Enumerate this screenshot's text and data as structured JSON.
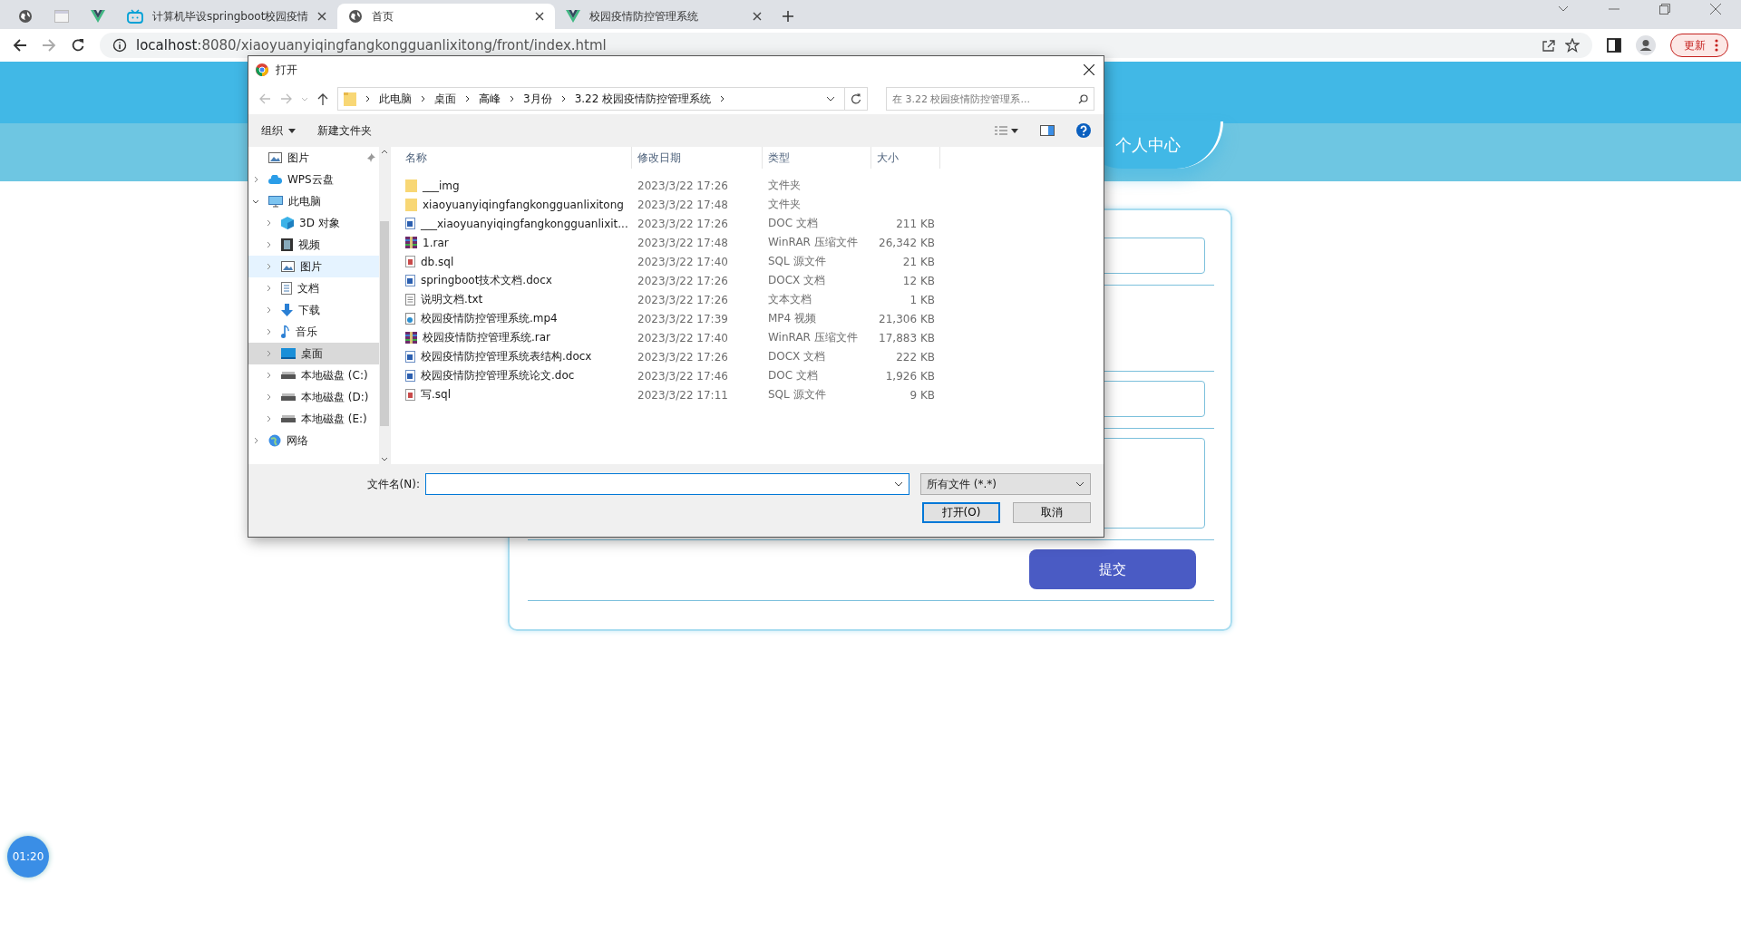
{
  "browser": {
    "tabs": [
      {
        "kind": "globe",
        "selected": false
      },
      {
        "kind": "blank",
        "selected": false
      },
      {
        "kind": "vue",
        "selected": false
      },
      {
        "label": "计算机毕设springboot校园疫情",
        "kind": "tv",
        "selected": false
      },
      {
        "label": "首页",
        "kind": "globe",
        "selected": true
      },
      {
        "label": "校园疫情防控管理系统",
        "kind": "vue",
        "selected": false
      }
    ],
    "address": {
      "host": "localhost",
      "rest": ":8080/xiaoyuanyiqingfangkongguanlixitong/front/index.html"
    },
    "update_button": "更新"
  },
  "page": {
    "nav_tab": "个人中心",
    "form": {
      "submit": "提交"
    },
    "timer": "01:20"
  },
  "dialog": {
    "title": "打开",
    "breadcrumb": [
      "此电脑",
      "桌面",
      "高峰",
      "3月份",
      "3.22  校园疫情防控管理系统"
    ],
    "search_placeholder": "在 3.22  校园疫情防控管理系...",
    "toolbar": {
      "organize": "组织",
      "new_folder": "新建文件夹"
    },
    "sidebar": [
      {
        "label": "图片",
        "kind": "picture",
        "pinned": true,
        "selected": false,
        "hover": false
      },
      {
        "label": "WPS云盘",
        "kind": "cloud",
        "selected": false,
        "hover": false,
        "expanded": false
      },
      {
        "label": "此电脑",
        "kind": "pc",
        "selected": false,
        "hover": false,
        "expanded": true,
        "children": [
          {
            "label": "3D 对象",
            "kind": "cube",
            "selected": false,
            "hover": false
          },
          {
            "label": "视频",
            "kind": "film",
            "selected": false,
            "hover": false
          },
          {
            "label": "图片",
            "kind": "picture",
            "selected": false,
            "hover": true
          },
          {
            "label": "文档",
            "kind": "doc",
            "selected": false,
            "hover": false
          },
          {
            "label": "下载",
            "kind": "download",
            "selected": false,
            "hover": false
          },
          {
            "label": "音乐",
            "kind": "music",
            "selected": false,
            "hover": false
          },
          {
            "label": "桌面",
            "kind": "desktop",
            "selected": true,
            "hover": false
          },
          {
            "label": "本地磁盘 (C:)",
            "kind": "drive",
            "selected": false,
            "hover": false
          },
          {
            "label": "本地磁盘 (D:)",
            "kind": "drive",
            "selected": false,
            "hover": false
          },
          {
            "label": "本地磁盘 (E:)",
            "kind": "drive",
            "selected": false,
            "hover": false
          }
        ]
      },
      {
        "label": "网络",
        "kind": "network",
        "selected": false,
        "hover": false,
        "expanded": false
      }
    ],
    "columns": [
      "名称",
      "修改日期",
      "类型",
      "大小"
    ],
    "files": [
      {
        "kind": "folder",
        "name": "___img",
        "date": "2023/3/22 17:26",
        "type": "文件夹"
      },
      {
        "kind": "folder",
        "name": "xiaoyuanyiqingfangkongguanlixitong",
        "date": "2023/3/22 17:48",
        "type": "文件夹"
      },
      {
        "kind": "word",
        "name": "___xiaoyuanyiqingfangkongguanlixit...",
        "date": "2023/3/22 17:26",
        "type": "DOC 文档",
        "size": "211 KB"
      },
      {
        "kind": "rar",
        "name": "1.rar",
        "date": "2023/3/22 17:48",
        "type": "WinRAR 压缩文件",
        "size": "26,342 KB"
      },
      {
        "kind": "sql",
        "name": "db.sql",
        "date": "2023/3/22 17:40",
        "type": "SQL 源文件",
        "size": "21 KB"
      },
      {
        "kind": "word",
        "name": "springboot技术文档.docx",
        "date": "2023/3/22 17:26",
        "type": "DOCX 文档",
        "size": "12 KB"
      },
      {
        "kind": "text",
        "name": "说明文档.txt",
        "date": "2023/3/22 17:26",
        "type": "文本文档",
        "size": "1 KB"
      },
      {
        "kind": "video",
        "name": "校园疫情防控管理系统.mp4",
        "date": "2023/3/22 17:39",
        "type": "MP4 视频",
        "size": "21,306 KB"
      },
      {
        "kind": "rar",
        "name": "校园疫情防控管理系统.rar",
        "date": "2023/3/22 17:40",
        "type": "WinRAR 压缩文件",
        "size": "17,883 KB"
      },
      {
        "kind": "word",
        "name": "校园疫情防控管理系统表结构.docx",
        "date": "2023/3/22 17:26",
        "type": "DOCX 文档",
        "size": "222 KB"
      },
      {
        "kind": "word",
        "name": "校园疫情防控管理系统论文.doc",
        "date": "2023/3/22 17:46",
        "type": "DOC 文档",
        "size": "1,926 KB"
      },
      {
        "kind": "sql",
        "name": "写.sql",
        "date": "2023/3/22 17:11",
        "type": "SQL 源文件",
        "size": "9 KB"
      }
    ],
    "filename_label": "文件名(N):",
    "filter": "所有文件 (*.*)",
    "open_button": "打开(O)",
    "cancel_button": "取消"
  }
}
